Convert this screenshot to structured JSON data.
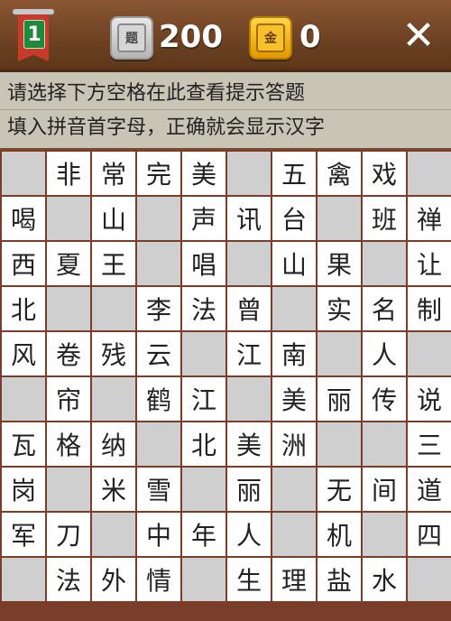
{
  "header": {
    "level": "1",
    "score": "200",
    "score_icon_label": "题",
    "gold": "0",
    "gold_icon_label": "金",
    "close_label": "✕",
    "icons": {
      "level": "level-flag-icon",
      "question": "question-icon",
      "gold": "gold-coin-icon",
      "close": "close-icon"
    }
  },
  "hints": {
    "line1": "请选择下方空格在此查看提示答题",
    "line2": "填入拼音首字母，正确就会显示汉字"
  },
  "colors": {
    "wood": "#7a4b2b",
    "board_border": "#7a3d2a",
    "blank_cell": "#cfcfcf",
    "open_cell": "#ffffff",
    "hint_bg": "#c8c4b6"
  },
  "board": {
    "rows": [
      [
        "",
        "非",
        "常",
        "完",
        "美",
        "",
        "五",
        "禽",
        "戏",
        ""
      ],
      [
        "喝",
        "",
        "山",
        "",
        "声",
        "讯",
        "台",
        "",
        "班",
        "禅"
      ],
      [
        "西",
        "夏",
        "王",
        "",
        "唱",
        "",
        "山",
        "果",
        "",
        "让"
      ],
      [
        "北",
        "",
        "",
        "李",
        "法",
        "曾",
        "",
        "实",
        "名",
        "制"
      ],
      [
        "风",
        "卷",
        "残",
        "云",
        "",
        "江",
        "南",
        "",
        "人",
        ""
      ],
      [
        "",
        "帘",
        "",
        "鹤",
        "江",
        "",
        "美",
        "丽",
        "传",
        "说"
      ],
      [
        "瓦",
        "格",
        "纳",
        "",
        "北",
        "美",
        "洲",
        "",
        "",
        "三"
      ],
      [
        "岗",
        "",
        "米",
        "雪",
        "",
        "丽",
        "",
        "无",
        "间",
        "道"
      ],
      [
        "军",
        "刀",
        "",
        "中",
        "年",
        "人",
        "",
        "机",
        "",
        "四"
      ],
      [
        "",
        "法",
        "外",
        "情",
        "",
        "生",
        "理",
        "盐",
        "水",
        ""
      ]
    ],
    "blank_map": [
      [
        1,
        0,
        0,
        0,
        0,
        1,
        0,
        0,
        0,
        1
      ],
      [
        0,
        1,
        0,
        1,
        0,
        0,
        0,
        1,
        0,
        0
      ],
      [
        0,
        0,
        0,
        1,
        0,
        1,
        0,
        0,
        1,
        0
      ],
      [
        0,
        1,
        1,
        0,
        0,
        0,
        1,
        0,
        0,
        0
      ],
      [
        0,
        0,
        0,
        0,
        1,
        0,
        0,
        1,
        0,
        1
      ],
      [
        1,
        0,
        1,
        0,
        0,
        1,
        0,
        0,
        0,
        0
      ],
      [
        0,
        0,
        0,
        1,
        0,
        0,
        0,
        1,
        1,
        0
      ],
      [
        0,
        1,
        0,
        0,
        1,
        0,
        1,
        0,
        0,
        0
      ],
      [
        0,
        0,
        1,
        0,
        0,
        0,
        1,
        0,
        1,
        0
      ],
      [
        1,
        0,
        0,
        0,
        1,
        0,
        0,
        0,
        0,
        1
      ]
    ]
  }
}
